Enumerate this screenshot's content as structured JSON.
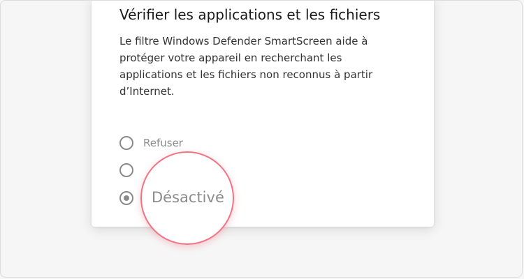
{
  "dialog": {
    "title": "Vérifier les applications et les fichiers",
    "description": "Le filtre Windows Defender SmartScreen aide à protéger votre appareil en recherchant les applications et les fichiers non reconnus à partir d’Internet."
  },
  "options": [
    {
      "label": "Refuser",
      "selected": false
    },
    {
      "label": "",
      "selected": false
    },
    {
      "label": "",
      "selected": true
    }
  ],
  "magnifier": {
    "label": "Désactivé"
  },
  "colors": {
    "highlight_ring": "#f07484",
    "radio": "#8a8a8a",
    "option_text": "#8c8c8c"
  }
}
